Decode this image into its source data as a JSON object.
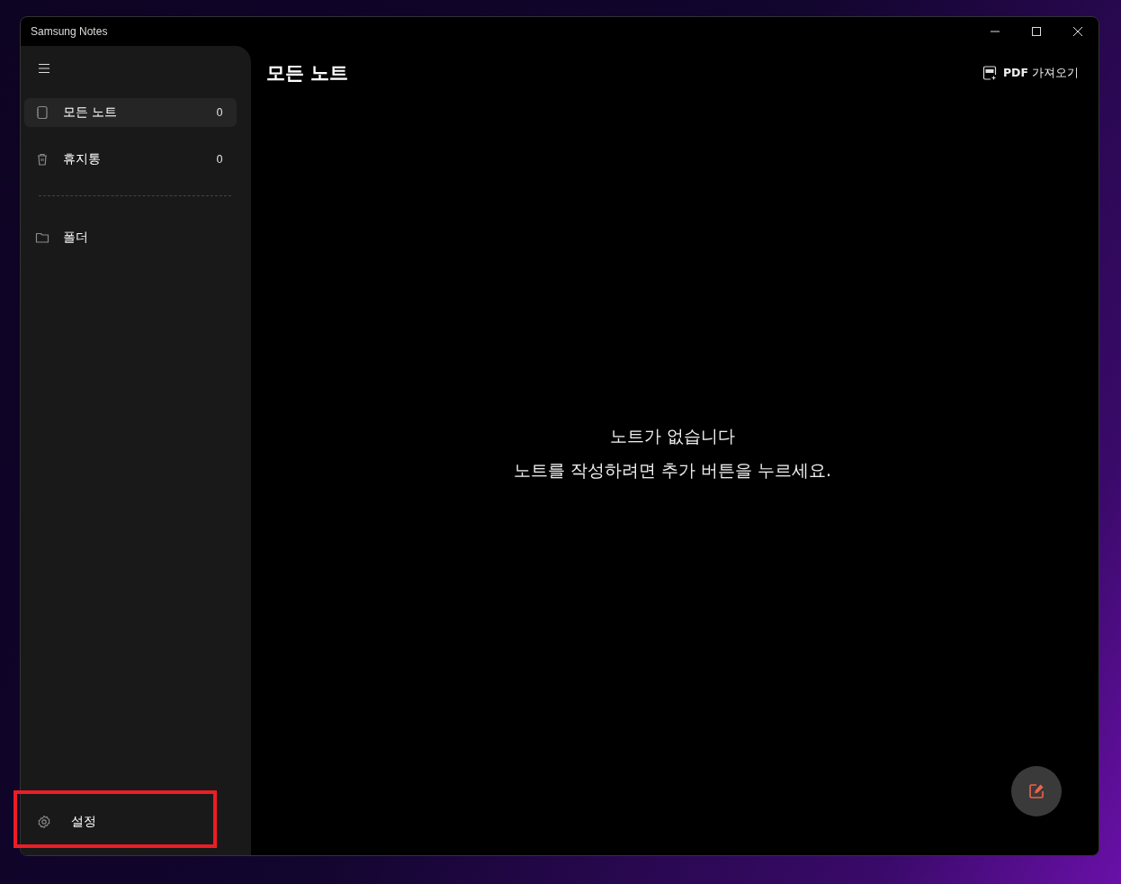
{
  "window": {
    "title": "Samsung Notes"
  },
  "sidebar": {
    "items": [
      {
        "kind": "notes",
        "label": "모든 노트",
        "count": "0",
        "selected": true
      },
      {
        "kind": "trash",
        "label": "휴지통",
        "count": "0",
        "selected": false
      },
      {
        "kind": "folder",
        "label": "폴더",
        "selected": false
      }
    ],
    "settings": {
      "label": "설정",
      "highlighted": true
    }
  },
  "main": {
    "title": "모든 노트",
    "import_button": "**PDF** 가져오기",
    "empty_title": "노트가 없습니다",
    "empty_hint": "노트를 작성하려면 추가 버튼을 누르세요."
  }
}
